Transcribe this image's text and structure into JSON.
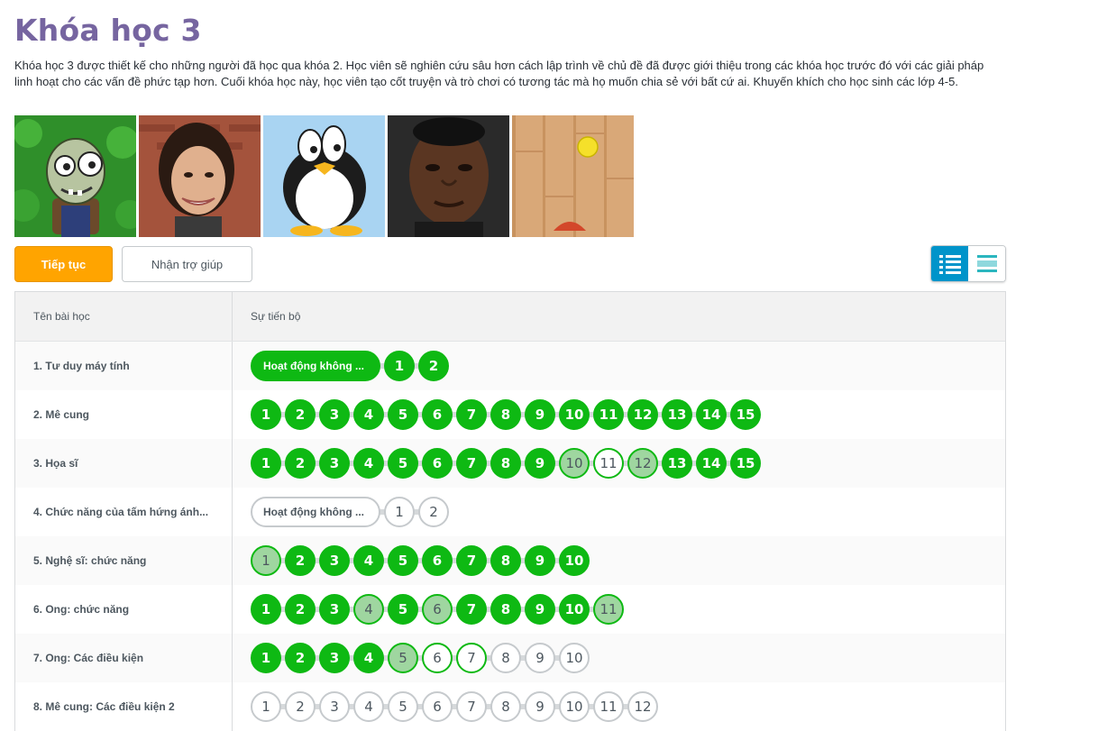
{
  "course": {
    "title": "Khóa học 3",
    "description": "Khóa học 3 được thiết kế cho những người đã học qua khóa 2. Học viên sẽ nghiên cứu sâu hơn cách lập trình về chủ đề đã được giới thiệu trong các khóa học trước đó với các giải pháp linh hoạt cho các vấn đề phức tạp hơn. Cuối khóa học này, học viên tạo cốt truyện và trò chơi có tương tác mà họ muốn chia sẻ với bất cứ ai. Khuyến khích cho học sinh các lớp 4-5."
  },
  "thumbnails": [
    "zombie-character-icon",
    "smiling-woman-photo",
    "penguin-character-icon",
    "man-portrait-photo",
    "wood-floor-ball-icon"
  ],
  "buttons": {
    "continue": "Tiếp tục",
    "help": "Nhận trợ giúp"
  },
  "view_toggle": {
    "active": "detail-list-view",
    "inactive": "summary-list-view",
    "active_color": "#0094ca"
  },
  "table": {
    "headers": {
      "name": "Tên bài học",
      "progress": "Sự tiến bộ"
    },
    "lessons": [
      {
        "name": "1. Tư duy máy tính",
        "pill": {
          "label": "Hoạt động không ...",
          "status": "perfect"
        },
        "levels": [
          {
            "n": "1",
            "s": "perfect"
          },
          {
            "n": "2",
            "s": "perfect"
          }
        ]
      },
      {
        "name": "2. Mê cung",
        "levels": [
          {
            "n": "1",
            "s": "perfect"
          },
          {
            "n": "2",
            "s": "perfect"
          },
          {
            "n": "3",
            "s": "perfect"
          },
          {
            "n": "4",
            "s": "perfect"
          },
          {
            "n": "5",
            "s": "perfect"
          },
          {
            "n": "6",
            "s": "perfect"
          },
          {
            "n": "7",
            "s": "perfect"
          },
          {
            "n": "8",
            "s": "perfect"
          },
          {
            "n": "9",
            "s": "perfect"
          },
          {
            "n": "10",
            "s": "perfect"
          },
          {
            "n": "11",
            "s": "perfect"
          },
          {
            "n": "12",
            "s": "perfect"
          },
          {
            "n": "13",
            "s": "perfect"
          },
          {
            "n": "14",
            "s": "perfect"
          },
          {
            "n": "15",
            "s": "perfect"
          }
        ]
      },
      {
        "name": "3. Họa sĩ",
        "levels": [
          {
            "n": "1",
            "s": "perfect"
          },
          {
            "n": "2",
            "s": "perfect"
          },
          {
            "n": "3",
            "s": "perfect"
          },
          {
            "n": "4",
            "s": "perfect"
          },
          {
            "n": "5",
            "s": "perfect"
          },
          {
            "n": "6",
            "s": "perfect"
          },
          {
            "n": "7",
            "s": "perfect"
          },
          {
            "n": "8",
            "s": "perfect"
          },
          {
            "n": "9",
            "s": "perfect"
          },
          {
            "n": "10",
            "s": "tried"
          },
          {
            "n": "11",
            "s": "attempted"
          },
          {
            "n": "12",
            "s": "tried"
          },
          {
            "n": "13",
            "s": "perfect"
          },
          {
            "n": "14",
            "s": "perfect"
          },
          {
            "n": "15",
            "s": "perfect"
          }
        ]
      },
      {
        "name": "4. Chức năng của tấm hứng ánh...",
        "pill": {
          "label": "Hoạt động không ...",
          "status": "empty"
        },
        "levels": [
          {
            "n": "1",
            "s": "empty"
          },
          {
            "n": "2",
            "s": "empty"
          }
        ]
      },
      {
        "name": "5. Nghệ sĩ: chức năng",
        "levels": [
          {
            "n": "1",
            "s": "tried"
          },
          {
            "n": "2",
            "s": "perfect"
          },
          {
            "n": "3",
            "s": "perfect"
          },
          {
            "n": "4",
            "s": "perfect"
          },
          {
            "n": "5",
            "s": "perfect"
          },
          {
            "n": "6",
            "s": "perfect"
          },
          {
            "n": "7",
            "s": "perfect"
          },
          {
            "n": "8",
            "s": "perfect"
          },
          {
            "n": "9",
            "s": "perfect"
          },
          {
            "n": "10",
            "s": "perfect"
          }
        ]
      },
      {
        "name": "6. Ong: chức năng",
        "levels": [
          {
            "n": "1",
            "s": "perfect"
          },
          {
            "n": "2",
            "s": "perfect"
          },
          {
            "n": "3",
            "s": "perfect"
          },
          {
            "n": "4",
            "s": "tried"
          },
          {
            "n": "5",
            "s": "perfect"
          },
          {
            "n": "6",
            "s": "tried"
          },
          {
            "n": "7",
            "s": "perfect"
          },
          {
            "n": "8",
            "s": "perfect"
          },
          {
            "n": "9",
            "s": "perfect"
          },
          {
            "n": "10",
            "s": "perfect"
          },
          {
            "n": "11",
            "s": "tried"
          }
        ]
      },
      {
        "name": "7. Ong: Các điều kiện",
        "levels": [
          {
            "n": "1",
            "s": "perfect"
          },
          {
            "n": "2",
            "s": "perfect"
          },
          {
            "n": "3",
            "s": "perfect"
          },
          {
            "n": "4",
            "s": "perfect"
          },
          {
            "n": "5",
            "s": "tried"
          },
          {
            "n": "6",
            "s": "attempted"
          },
          {
            "n": "7",
            "s": "attempted"
          },
          {
            "n": "8",
            "s": "empty"
          },
          {
            "n": "9",
            "s": "empty"
          },
          {
            "n": "10",
            "s": "empty"
          }
        ]
      },
      {
        "name": "8. Mê cung: Các điều kiện 2",
        "levels": [
          {
            "n": "1",
            "s": "empty"
          },
          {
            "n": "2",
            "s": "empty"
          },
          {
            "n": "3",
            "s": "empty"
          },
          {
            "n": "4",
            "s": "empty"
          },
          {
            "n": "5",
            "s": "empty"
          },
          {
            "n": "6",
            "s": "empty"
          },
          {
            "n": "7",
            "s": "empty"
          },
          {
            "n": "8",
            "s": "empty"
          },
          {
            "n": "9",
            "s": "empty"
          },
          {
            "n": "10",
            "s": "empty"
          },
          {
            "n": "11",
            "s": "empty"
          },
          {
            "n": "12",
            "s": "empty"
          }
        ]
      }
    ]
  },
  "colors": {
    "title": "#7665a0",
    "perfect": "#0eb913",
    "tried_fill": "#9fd6a0",
    "continue": "#ffa400",
    "empty_border": "#c6cacd"
  }
}
